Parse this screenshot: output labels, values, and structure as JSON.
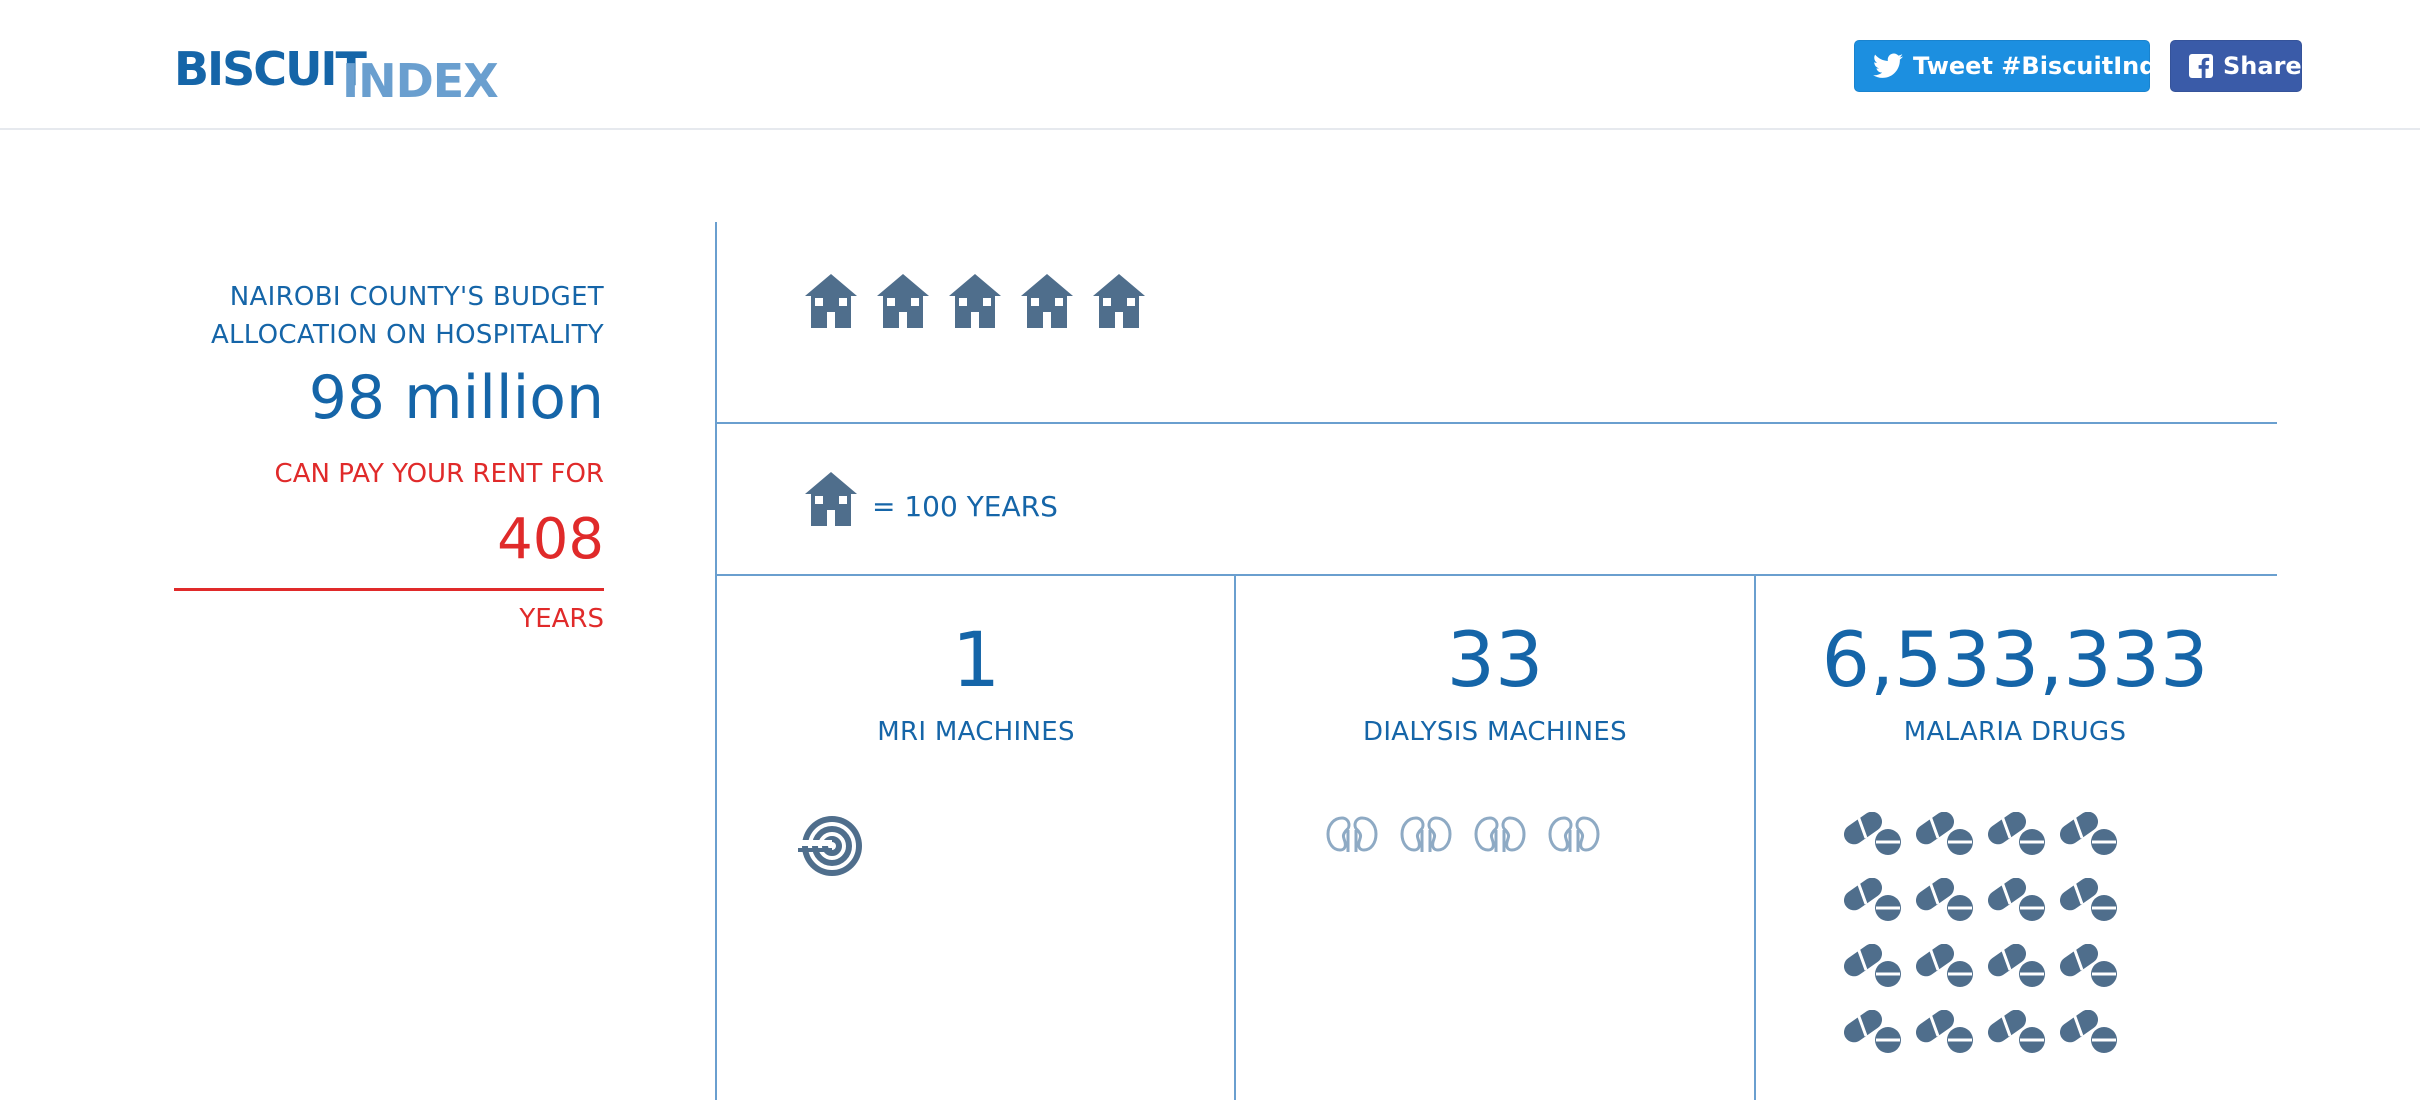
{
  "header": {
    "logo": {
      "part1": "BISCUIT",
      "part2": "INDEX"
    },
    "tweet_label": "Tweet #BiscuitIndex",
    "share_label": "Share"
  },
  "summary": {
    "label_line1": "NAIROBI COUNTY'S BUDGET",
    "label_line2": "ALLOCATION ON HOSPITALITY",
    "amount": "98 million",
    "rent_label": "CAN PAY YOUR RENT FOR",
    "years_value": "408",
    "years_label": "YEARS"
  },
  "houses": {
    "count": 5,
    "icon": "house-icon"
  },
  "legend": {
    "icon": "house-icon",
    "text": "= 100 YEARS"
  },
  "stats": [
    {
      "value": "1",
      "label": "MRI MACHINES",
      "icon": "mri-machine-icon"
    },
    {
      "value": "33",
      "label": "DIALYSIS MACHINES",
      "icon": "kidney-icon"
    },
    {
      "value": "6,533,333",
      "label": "MALARIA DRUGS",
      "icon": "pill-icon"
    }
  ],
  "colors": {
    "primary": "#1565a8",
    "secondary": "#6a9fcf",
    "accent_red": "#e02a2a",
    "icon_slate": "#4f6e8c",
    "twitter": "#1c8fe0",
    "facebook": "#3a5ba8"
  }
}
